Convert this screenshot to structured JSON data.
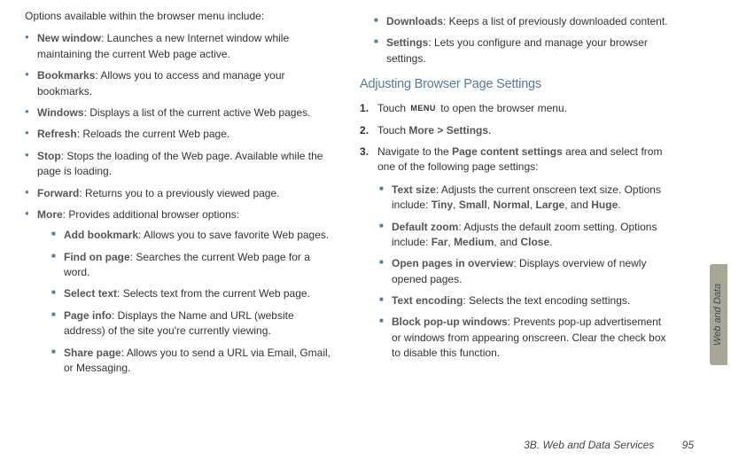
{
  "left": {
    "intro": "Options available within the browser menu include:",
    "items": [
      {
        "term": "New window",
        "desc": ": Launches a new Internet window while maintaining the current Web page active."
      },
      {
        "term": "Bookmarks",
        "desc": ": Allows you to access and manage your bookmarks."
      },
      {
        "term": "Windows",
        "desc": ": Displays a list of the current active Web pages."
      },
      {
        "term": "Refresh",
        "desc": ": Reloads the current Web page."
      },
      {
        "term": "Stop",
        "desc": ": Stops the loading of the Web page. Available while the page is loading."
      },
      {
        "term": "Forward",
        "desc": ": Returns you to a previously viewed page."
      },
      {
        "term": "More",
        "desc": ": Provides additional browser options:"
      }
    ],
    "more": [
      {
        "term": "Add bookmark",
        "desc": ": Allows you to save favorite Web pages."
      },
      {
        "term": "Find on page",
        "desc": ": Searches the current Web page for a word."
      },
      {
        "term": "Select text",
        "desc": ": Selects text from the current Web page."
      },
      {
        "term": "Page info",
        "desc": ": Displays the Name and URL (website address) of the site you're currently viewing."
      },
      {
        "term": "Share page",
        "desc": ": Allows you to send a URL via Email, Gmail, or Messaging."
      }
    ]
  },
  "right": {
    "cont": [
      {
        "term": "Downloads",
        "desc": ": Keeps a list of previously downloaded content."
      },
      {
        "term": "Settings",
        "desc": ": Lets you configure and manage your browser settings."
      }
    ],
    "heading": "Adjusting Browser Page Settings",
    "steps": {
      "s1a": "Touch ",
      "menu_chip": "MENU",
      "s1b": " to open the browser menu.",
      "s2a": "Touch ",
      "s2_more": "More",
      "s2_gt": " > ",
      "s2_settings": "Settings",
      "s2b": ".",
      "s3a": "Navigate to the ",
      "s3_pcs": "Page content settings",
      "s3b": " area and select from one of the following page settings:"
    },
    "settings": [
      {
        "term": "Text size",
        "pre": ": Adjusts the current onscreen text size. Options include: ",
        "opt1": "Tiny",
        "c1": ", ",
        "opt2": "Small",
        "c2": ", ",
        "opt3": "Normal",
        "c3": ", ",
        "opt4": "Large",
        "c4": ", and ",
        "opt5": "Huge",
        "post": "."
      },
      {
        "term": "Default zoom",
        "pre": ": Adjusts the default zoom setting. Options include: ",
        "opt1": "Far",
        "c1": ", ",
        "opt2": "Medium",
        "c2": ", and ",
        "opt3": "Close",
        "post": "."
      },
      {
        "term": "Open pages in overview",
        "desc": ": Displays overview of newly opened pages."
      },
      {
        "term": "Text encoding",
        "desc": ": Selects the text encoding settings."
      },
      {
        "term": "Block pop-up windows",
        "desc": ": Prevents pop-up advertisement or windows from appearing onscreen. Clear the check box to disable this function."
      }
    ]
  },
  "sidetab": "Web and Data",
  "footer": {
    "section": "3B. Web and Data Services",
    "page": "95"
  }
}
